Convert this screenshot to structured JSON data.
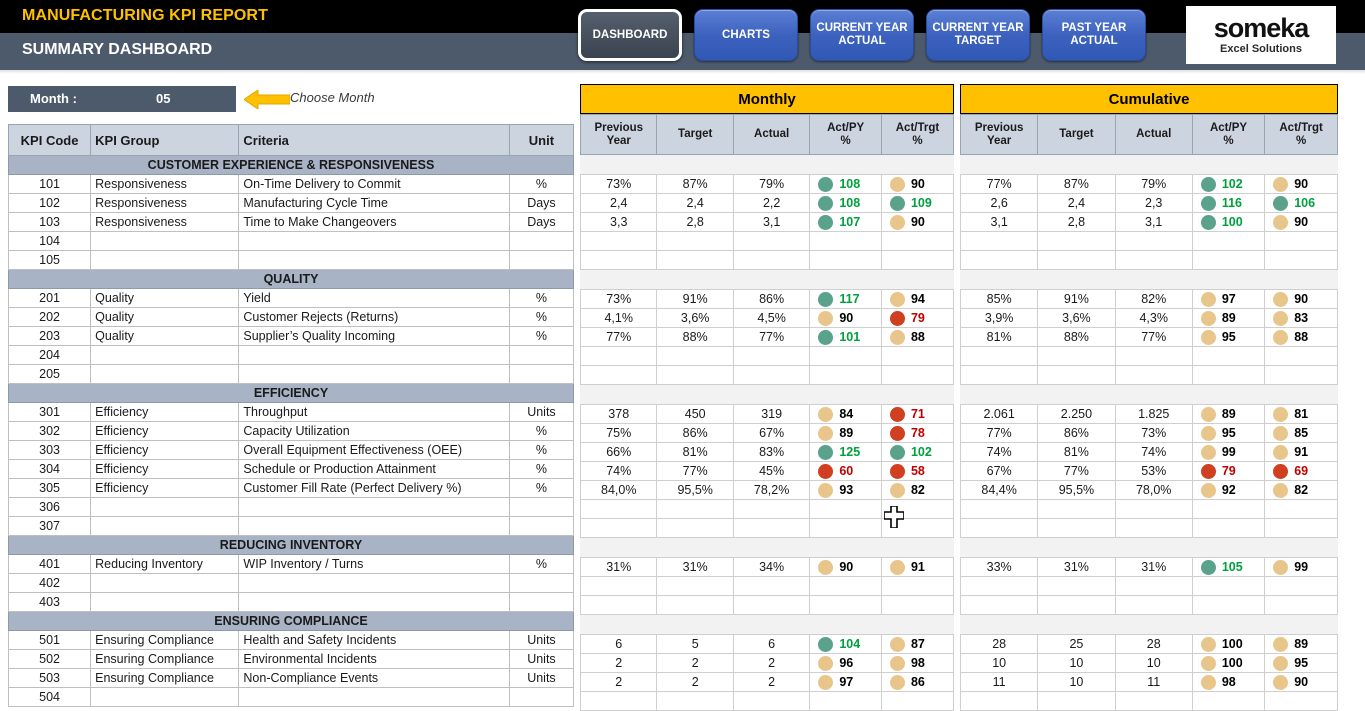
{
  "header": {
    "title": "MANUFACTURING KPI REPORT",
    "subtitle": "SUMMARY DASHBOARD",
    "nav": [
      {
        "label": "DASHBOARD",
        "name": "nav-dashboard",
        "active": true
      },
      {
        "label": "CHARTS",
        "name": "nav-charts",
        "active": false
      },
      {
        "label": "CURRENT YEAR ACTUAL",
        "name": "nav-current-year-actual",
        "active": false
      },
      {
        "label": "CURRENT YEAR TARGET",
        "name": "nav-current-year-target",
        "active": false
      },
      {
        "label": "PAST YEAR ACTUAL",
        "name": "nav-past-year-actual",
        "active": false
      }
    ],
    "logo_brand": "someka",
    "logo_tagline": "Excel Solutions"
  },
  "controls": {
    "month_label": "Month :",
    "month_value": "05",
    "choose_month_hint": "Choose Month"
  },
  "left_table": {
    "columns": [
      "KPI Code",
      "KPI Group",
      "Criteria",
      "Unit"
    ]
  },
  "panels": {
    "monthly_title": "Monthly",
    "cumulative_title": "Cumulative",
    "columns": [
      "Previous Year",
      "Target",
      "Actual",
      "Act/PY %",
      "Act/Trgt %"
    ],
    "columns_split": [
      {
        "l1": "Previous",
        "l2": "Year"
      },
      {
        "l1": "Target",
        "l2": ""
      },
      {
        "l1": "Actual",
        "l2": ""
      },
      {
        "l1": "Act/PY",
        "l2": "%"
      },
      {
        "l1": "Act/Trgt",
        "l2": "%"
      }
    ]
  },
  "colors": {
    "accent_yellow": "#ffc000",
    "header_black": "#000000",
    "header_slate": "#4d5a6b",
    "section_band": "#a8b4c6",
    "dot_green": "#5aa28c",
    "dot_amber": "#e8c58a",
    "dot_red": "#cf3f20",
    "text_green": "#00a03c",
    "text_red": "#c00000"
  },
  "sections": [
    {
      "name": "CUSTOMER EXPERIENCE & RESPONSIVENESS",
      "rows": [
        {
          "code": "101",
          "group": "Responsiveness",
          "criteria": "On-Time Delivery to Commit",
          "unit": "%",
          "monthly": {
            "py": "73%",
            "target": "87%",
            "actual": "79%",
            "act_py": "108",
            "act_py_status": "green",
            "act_trgt": "90",
            "act_trgt_status": "amber"
          },
          "cumulative": {
            "py": "77%",
            "target": "87%",
            "actual": "79%",
            "act_py": "102",
            "act_py_status": "green",
            "act_trgt": "90",
            "act_trgt_status": "amber"
          }
        },
        {
          "code": "102",
          "group": "Responsiveness",
          "criteria": "Manufacturing Cycle Time",
          "unit": "Days",
          "monthly": {
            "py": "2,4",
            "target": "2,4",
            "actual": "2,2",
            "act_py": "108",
            "act_py_status": "green",
            "act_trgt": "109",
            "act_trgt_status": "green"
          },
          "cumulative": {
            "py": "2,6",
            "target": "2,4",
            "actual": "2,3",
            "act_py": "116",
            "act_py_status": "green",
            "act_trgt": "106",
            "act_trgt_status": "green"
          }
        },
        {
          "code": "103",
          "group": "Responsiveness",
          "criteria": "Time to Make Changeovers",
          "unit": "Days",
          "monthly": {
            "py": "3,3",
            "target": "2,8",
            "actual": "3,1",
            "act_py": "107",
            "act_py_status": "green",
            "act_trgt": "90",
            "act_trgt_status": "amber"
          },
          "cumulative": {
            "py": "3,1",
            "target": "2,8",
            "actual": "3,1",
            "act_py": "100",
            "act_py_status": "green",
            "act_trgt": "90",
            "act_trgt_status": "amber"
          }
        },
        {
          "code": "104",
          "group": "",
          "criteria": "",
          "unit": "",
          "monthly": {
            "py": "",
            "target": "",
            "actual": "",
            "act_py": "",
            "act_py_status": "",
            "act_trgt": "",
            "act_trgt_status": ""
          },
          "cumulative": {
            "py": "",
            "target": "",
            "actual": "",
            "act_py": "",
            "act_py_status": "",
            "act_trgt": "",
            "act_trgt_status": ""
          }
        },
        {
          "code": "105",
          "group": "",
          "criteria": "",
          "unit": "",
          "monthly": {
            "py": "",
            "target": "",
            "actual": "",
            "act_py": "",
            "act_py_status": "",
            "act_trgt": "",
            "act_trgt_status": ""
          },
          "cumulative": {
            "py": "",
            "target": "",
            "actual": "",
            "act_py": "",
            "act_py_status": "",
            "act_trgt": "",
            "act_trgt_status": ""
          }
        }
      ]
    },
    {
      "name": "QUALITY",
      "rows": [
        {
          "code": "201",
          "group": "Quality",
          "criteria": "Yield",
          "unit": "%",
          "monthly": {
            "py": "73%",
            "target": "91%",
            "actual": "86%",
            "act_py": "117",
            "act_py_status": "green",
            "act_trgt": "94",
            "act_trgt_status": "amber"
          },
          "cumulative": {
            "py": "85%",
            "target": "91%",
            "actual": "82%",
            "act_py": "97",
            "act_py_status": "amber",
            "act_trgt": "90",
            "act_trgt_status": "amber"
          }
        },
        {
          "code": "202",
          "group": "Quality",
          "criteria": "Customer Rejects (Returns)",
          "unit": "%",
          "monthly": {
            "py": "4,1%",
            "target": "3,6%",
            "actual": "4,5%",
            "act_py": "90",
            "act_py_status": "amber",
            "act_trgt": "79",
            "act_trgt_status": "red"
          },
          "cumulative": {
            "py": "3,9%",
            "target": "3,6%",
            "actual": "4,3%",
            "act_py": "89",
            "act_py_status": "amber",
            "act_trgt": "83",
            "act_trgt_status": "amber"
          }
        },
        {
          "code": "203",
          "group": "Quality",
          "criteria": "Supplier’s Quality Incoming",
          "unit": "%",
          "monthly": {
            "py": "77%",
            "target": "88%",
            "actual": "77%",
            "act_py": "101",
            "act_py_status": "green",
            "act_trgt": "88",
            "act_trgt_status": "amber"
          },
          "cumulative": {
            "py": "81%",
            "target": "88%",
            "actual": "77%",
            "act_py": "95",
            "act_py_status": "amber",
            "act_trgt": "88",
            "act_trgt_status": "amber"
          }
        },
        {
          "code": "204",
          "group": "",
          "criteria": "",
          "unit": "",
          "monthly": {
            "py": "",
            "target": "",
            "actual": "",
            "act_py": "",
            "act_py_status": "",
            "act_trgt": "",
            "act_trgt_status": ""
          },
          "cumulative": {
            "py": "",
            "target": "",
            "actual": "",
            "act_py": "",
            "act_py_status": "",
            "act_trgt": "",
            "act_trgt_status": ""
          }
        },
        {
          "code": "205",
          "group": "",
          "criteria": "",
          "unit": "",
          "monthly": {
            "py": "",
            "target": "",
            "actual": "",
            "act_py": "",
            "act_py_status": "",
            "act_trgt": "",
            "act_trgt_status": ""
          },
          "cumulative": {
            "py": "",
            "target": "",
            "actual": "",
            "act_py": "",
            "act_py_status": "",
            "act_trgt": "",
            "act_trgt_status": ""
          }
        }
      ]
    },
    {
      "name": "EFFICIENCY",
      "rows": [
        {
          "code": "301",
          "group": "Efficiency",
          "criteria": "Throughput",
          "unit": "Units",
          "monthly": {
            "py": "378",
            "target": "450",
            "actual": "319",
            "act_py": "84",
            "act_py_status": "amber",
            "act_trgt": "71",
            "act_trgt_status": "red"
          },
          "cumulative": {
            "py": "2.061",
            "target": "2.250",
            "actual": "1.825",
            "act_py": "89",
            "act_py_status": "amber",
            "act_trgt": "81",
            "act_trgt_status": "amber"
          }
        },
        {
          "code": "302",
          "group": "Efficiency",
          "criteria": "Capacity Utilization",
          "unit": "%",
          "monthly": {
            "py": "75%",
            "target": "86%",
            "actual": "67%",
            "act_py": "89",
            "act_py_status": "amber",
            "act_trgt": "78",
            "act_trgt_status": "red"
          },
          "cumulative": {
            "py": "77%",
            "target": "86%",
            "actual": "73%",
            "act_py": "95",
            "act_py_status": "amber",
            "act_trgt": "85",
            "act_trgt_status": "amber"
          }
        },
        {
          "code": "303",
          "group": "Efficiency",
          "criteria": "Overall Equipment Effectiveness (OEE)",
          "unit": "%",
          "monthly": {
            "py": "66%",
            "target": "81%",
            "actual": "83%",
            "act_py": "125",
            "act_py_status": "green",
            "act_trgt": "102",
            "act_trgt_status": "green"
          },
          "cumulative": {
            "py": "74%",
            "target": "81%",
            "actual": "74%",
            "act_py": "99",
            "act_py_status": "amber",
            "act_trgt": "91",
            "act_trgt_status": "amber"
          }
        },
        {
          "code": "304",
          "group": "Efficiency",
          "criteria": "Schedule or Production Attainment",
          "unit": "%",
          "monthly": {
            "py": "74%",
            "target": "77%",
            "actual": "45%",
            "act_py": "60",
            "act_py_status": "red",
            "act_trgt": "58",
            "act_trgt_status": "red"
          },
          "cumulative": {
            "py": "67%",
            "target": "77%",
            "actual": "53%",
            "act_py": "79",
            "act_py_status": "red",
            "act_trgt": "69",
            "act_trgt_status": "red"
          }
        },
        {
          "code": "305",
          "group": "Efficiency",
          "criteria": "Customer Fill Rate (Perfect Delivery %)",
          "unit": "%",
          "monthly": {
            "py": "84,0%",
            "target": "95,5%",
            "actual": "78,2%",
            "act_py": "93",
            "act_py_status": "amber",
            "act_trgt": "82",
            "act_trgt_status": "amber"
          },
          "cumulative": {
            "py": "84,4%",
            "target": "95,5%",
            "actual": "78,0%",
            "act_py": "92",
            "act_py_status": "amber",
            "act_trgt": "82",
            "act_trgt_status": "amber"
          }
        },
        {
          "code": "306",
          "group": "",
          "criteria": "",
          "unit": "",
          "monthly": {
            "py": "",
            "target": "",
            "actual": "",
            "act_py": "",
            "act_py_status": "",
            "act_trgt": "",
            "act_trgt_status": ""
          },
          "cumulative": {
            "py": "",
            "target": "",
            "actual": "",
            "act_py": "",
            "act_py_status": "",
            "act_trgt": "",
            "act_trgt_status": ""
          }
        },
        {
          "code": "307",
          "group": "",
          "criteria": "",
          "unit": "",
          "monthly": {
            "py": "",
            "target": "",
            "actual": "",
            "act_py": "",
            "act_py_status": "",
            "act_trgt": "",
            "act_trgt_status": ""
          },
          "cumulative": {
            "py": "",
            "target": "",
            "actual": "",
            "act_py": "",
            "act_py_status": "",
            "act_trgt": "",
            "act_trgt_status": ""
          }
        }
      ]
    },
    {
      "name": "REDUCING INVENTORY",
      "rows": [
        {
          "code": "401",
          "group": "Reducing Inventory",
          "criteria": "WIP Inventory / Turns",
          "unit": "%",
          "monthly": {
            "py": "31%",
            "target": "31%",
            "actual": "34%",
            "act_py": "90",
            "act_py_status": "amber",
            "act_trgt": "91",
            "act_trgt_status": "amber"
          },
          "cumulative": {
            "py": "33%",
            "target": "31%",
            "actual": "31%",
            "act_py": "105",
            "act_py_status": "green",
            "act_trgt": "99",
            "act_trgt_status": "amber"
          }
        },
        {
          "code": "402",
          "group": "",
          "criteria": "",
          "unit": "",
          "monthly": {
            "py": "",
            "target": "",
            "actual": "",
            "act_py": "",
            "act_py_status": "",
            "act_trgt": "",
            "act_trgt_status": ""
          },
          "cumulative": {
            "py": "",
            "target": "",
            "actual": "",
            "act_py": "",
            "act_py_status": "",
            "act_trgt": "",
            "act_trgt_status": ""
          }
        },
        {
          "code": "403",
          "group": "",
          "criteria": "",
          "unit": "",
          "monthly": {
            "py": "",
            "target": "",
            "actual": "",
            "act_py": "",
            "act_py_status": "",
            "act_trgt": "",
            "act_trgt_status": ""
          },
          "cumulative": {
            "py": "",
            "target": "",
            "actual": "",
            "act_py": "",
            "act_py_status": "",
            "act_trgt": "",
            "act_trgt_status": ""
          }
        }
      ]
    },
    {
      "name": "ENSURING COMPLIANCE",
      "rows": [
        {
          "code": "501",
          "group": "Ensuring Compliance",
          "criteria": "Health and Safety Incidents",
          "unit": "Units",
          "monthly": {
            "py": "6",
            "target": "5",
            "actual": "6",
            "act_py": "104",
            "act_py_status": "green",
            "act_trgt": "87",
            "act_trgt_status": "amber"
          },
          "cumulative": {
            "py": "28",
            "target": "25",
            "actual": "28",
            "act_py": "100",
            "act_py_status": "amber",
            "act_trgt": "89",
            "act_trgt_status": "amber"
          }
        },
        {
          "code": "502",
          "group": "Ensuring Compliance",
          "criteria": "Environmental Incidents",
          "unit": "Units",
          "monthly": {
            "py": "2",
            "target": "2",
            "actual": "2",
            "act_py": "96",
            "act_py_status": "amber",
            "act_trgt": "98",
            "act_trgt_status": "amber"
          },
          "cumulative": {
            "py": "10",
            "target": "10",
            "actual": "10",
            "act_py": "100",
            "act_py_status": "amber",
            "act_trgt": "95",
            "act_trgt_status": "amber"
          }
        },
        {
          "code": "503",
          "group": "Ensuring Compliance",
          "criteria": "Non-Compliance Events",
          "unit": "Units",
          "monthly": {
            "py": "2",
            "target": "2",
            "actual": "2",
            "act_py": "97",
            "act_py_status": "amber",
            "act_trgt": "86",
            "act_trgt_status": "amber"
          },
          "cumulative": {
            "py": "11",
            "target": "10",
            "actual": "11",
            "act_py": "98",
            "act_py_status": "amber",
            "act_trgt": "90",
            "act_trgt_status": "amber"
          }
        },
        {
          "code": "504",
          "group": "",
          "criteria": "",
          "unit": "",
          "monthly": {
            "py": "",
            "target": "",
            "actual": "",
            "act_py": "",
            "act_py_status": "",
            "act_trgt": "",
            "act_trgt_status": ""
          },
          "cumulative": {
            "py": "",
            "target": "",
            "actual": "",
            "act_py": "",
            "act_py_status": "",
            "act_trgt": "",
            "act_trgt_status": ""
          }
        }
      ]
    }
  ]
}
